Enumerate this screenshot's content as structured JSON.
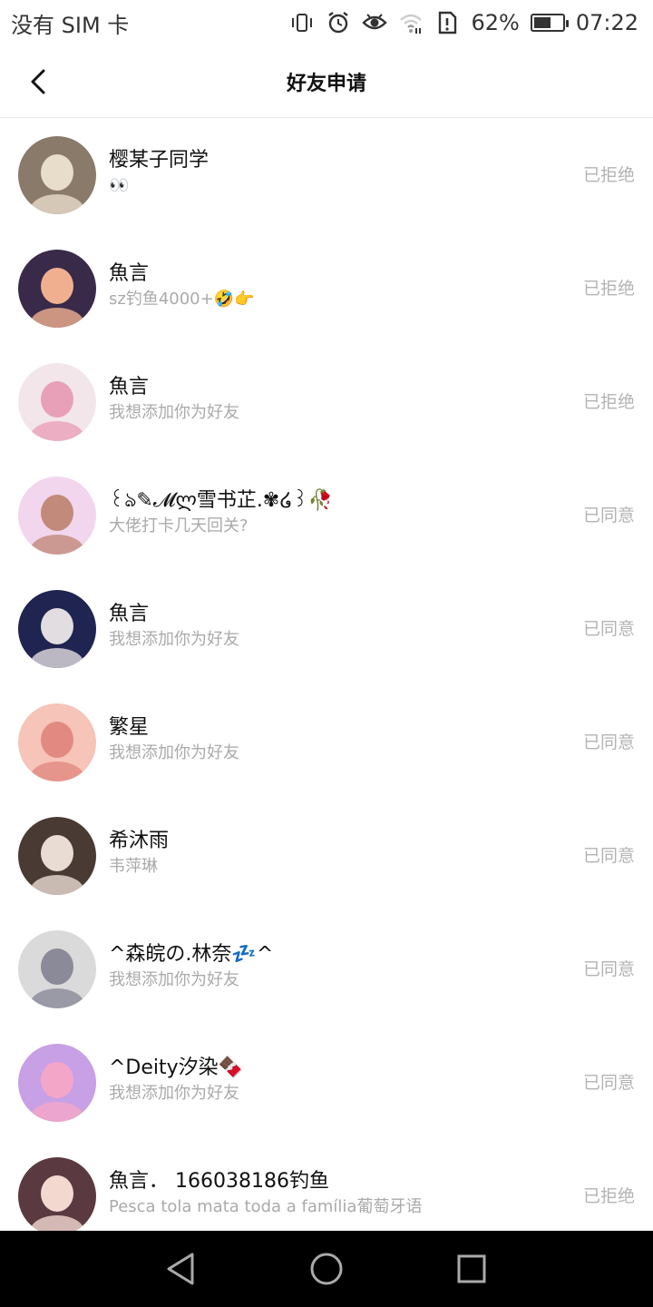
{
  "status_bar": {
    "carrier": "没有 SIM 卡",
    "battery_percent": "62%",
    "battery_level": 0.62,
    "time": "07:22",
    "icons": [
      "vibrate-icon",
      "alarm-icon",
      "eye-icon",
      "wifi-icon",
      "alert-icon",
      "battery-icon"
    ]
  },
  "header": {
    "title": "好友申请",
    "back_icon": "back-arrow-icon"
  },
  "requests": [
    {
      "name": "樱某子同学",
      "message": "👀",
      "status": "已拒绝",
      "avatar_color": "#8a7a6a",
      "avatar_accent": "#e8dccb"
    },
    {
      "name": "魚言",
      "message": "sz钓鱼4000+🤣👉",
      "status": "已拒绝",
      "avatar_color": "#3a2a4a",
      "avatar_accent": "#f0b090"
    },
    {
      "name": "魚言",
      "message": "我想添加你为好友",
      "status": "已拒绝",
      "avatar_color": "#f3e6ea",
      "avatar_accent": "#e8a0b8"
    },
    {
      "name": "꒰ঌ✎𝓜ლ雪书芷.✾໒꒱🥀",
      "message": "大佬打卡几天回关?",
      "status": "已同意",
      "avatar_color": "#f2d6ee",
      "avatar_accent": "#c28a7a"
    },
    {
      "name": "魚言",
      "message": "我想添加你为好友",
      "status": "已同意",
      "avatar_color": "#1f2450",
      "avatar_accent": "#e2dde0"
    },
    {
      "name": "繁星",
      "message": "我想添加你为好友",
      "status": "已同意",
      "avatar_color": "#f6c4b8",
      "avatar_accent": "#e28a82"
    },
    {
      "name": "希沐雨",
      "message": "韦萍琳",
      "status": "已同意",
      "avatar_color": "#4a3a34",
      "avatar_accent": "#e9dcd2"
    },
    {
      "name": "^森皖の.林奈💤^",
      "message": "我想添加你为好友",
      "status": "已同意",
      "avatar_color": "#dadada",
      "avatar_accent": "#8a8a98"
    },
    {
      "name": "^Deity汐染🍫",
      "message": "我想添加你为好友",
      "status": "已同意",
      "avatar_color": "#c8a0e6",
      "avatar_accent": "#f4a6c8"
    },
    {
      "name": "魚言．  166038186钓鱼",
      "message": "Pesca tola mata toda a família葡萄牙语",
      "status": "已拒绝",
      "avatar_color": "#5a3a40",
      "avatar_accent": "#f3d8d0"
    }
  ],
  "nav_bar": {
    "icons": [
      "nav-back-icon",
      "nav-home-icon",
      "nav-recents-icon"
    ]
  }
}
